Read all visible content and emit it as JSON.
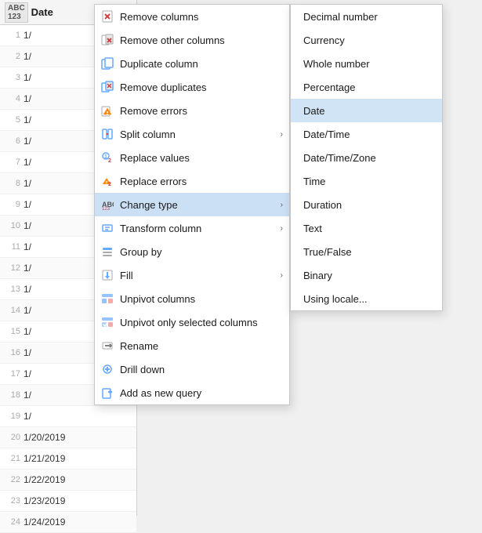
{
  "grid": {
    "header": {
      "type_badge": "ABC\n123",
      "column_name": "Date"
    },
    "rows": [
      {
        "num": 1,
        "value": "1/"
      },
      {
        "num": 2,
        "value": "1/"
      },
      {
        "num": 3,
        "value": "1/"
      },
      {
        "num": 4,
        "value": "1/"
      },
      {
        "num": 5,
        "value": "1/"
      },
      {
        "num": 6,
        "value": "1/"
      },
      {
        "num": 7,
        "value": "1/"
      },
      {
        "num": 8,
        "value": "1/"
      },
      {
        "num": 9,
        "value": "1/"
      },
      {
        "num": 10,
        "value": "1/"
      },
      {
        "num": 11,
        "value": "1/"
      },
      {
        "num": 12,
        "value": "1/"
      },
      {
        "num": 13,
        "value": "1/"
      },
      {
        "num": 14,
        "value": "1/"
      },
      {
        "num": 15,
        "value": "1/"
      },
      {
        "num": 16,
        "value": "1/"
      },
      {
        "num": 17,
        "value": "1/"
      },
      {
        "num": 18,
        "value": "1/"
      },
      {
        "num": 19,
        "value": "1/"
      },
      {
        "num": 20,
        "value": "1/20/2019"
      },
      {
        "num": 21,
        "value": "1/21/2019"
      },
      {
        "num": 22,
        "value": "1/22/2019"
      },
      {
        "num": 23,
        "value": "1/23/2019"
      },
      {
        "num": 24,
        "value": "1/24/2019"
      }
    ]
  },
  "context_menu": {
    "items": [
      {
        "id": "remove-columns",
        "label": "Remove columns",
        "has_arrow": false,
        "icon": "x-icon"
      },
      {
        "id": "remove-other-columns",
        "label": "Remove other columns",
        "has_arrow": false,
        "icon": "x-other-icon"
      },
      {
        "id": "duplicate-column",
        "label": "Duplicate column",
        "has_arrow": false,
        "icon": "dup-icon"
      },
      {
        "id": "remove-duplicates",
        "label": "Remove duplicates",
        "has_arrow": false,
        "icon": "dup-x-icon"
      },
      {
        "id": "remove-errors",
        "label": "Remove errors",
        "has_arrow": false,
        "icon": "err-icon"
      },
      {
        "id": "split-column",
        "label": "Split column",
        "has_arrow": true,
        "icon": "split-icon"
      },
      {
        "id": "replace-values",
        "label": "Replace values",
        "has_arrow": false,
        "icon": "replace-icon"
      },
      {
        "id": "replace-errors",
        "label": "Replace errors",
        "has_arrow": false,
        "icon": "replace-err-icon"
      },
      {
        "id": "change-type",
        "label": "Change type",
        "has_arrow": true,
        "icon": "type-icon",
        "active": true
      },
      {
        "id": "transform-column",
        "label": "Transform column",
        "has_arrow": true,
        "icon": "transform-icon"
      },
      {
        "id": "group-by",
        "label": "Group by",
        "has_arrow": false,
        "icon": "group-icon"
      },
      {
        "id": "fill",
        "label": "Fill",
        "has_arrow": true,
        "icon": "fill-icon"
      },
      {
        "id": "unpivot-columns",
        "label": "Unpivot columns",
        "has_arrow": false,
        "icon": "unpivot-icon"
      },
      {
        "id": "unpivot-selected",
        "label": "Unpivot only selected columns",
        "has_arrow": false,
        "icon": "unpivot-sel-icon"
      },
      {
        "id": "rename",
        "label": "Rename",
        "has_arrow": false,
        "icon": "rename-icon"
      },
      {
        "id": "drill-down",
        "label": "Drill down",
        "has_arrow": false,
        "icon": "drill-icon"
      },
      {
        "id": "add-query",
        "label": "Add as new query",
        "has_arrow": false,
        "icon": "add-icon"
      }
    ]
  },
  "submenu_changetype": {
    "items": [
      {
        "id": "decimal",
        "label": "Decimal number",
        "selected": false
      },
      {
        "id": "currency",
        "label": "Currency",
        "selected": false
      },
      {
        "id": "whole",
        "label": "Whole number",
        "selected": false
      },
      {
        "id": "percentage",
        "label": "Percentage",
        "selected": false
      },
      {
        "id": "date",
        "label": "Date",
        "selected": true
      },
      {
        "id": "datetime",
        "label": "Date/Time",
        "selected": false
      },
      {
        "id": "datetimezone",
        "label": "Date/Time/Zone",
        "selected": false
      },
      {
        "id": "time",
        "label": "Time",
        "selected": false
      },
      {
        "id": "duration",
        "label": "Duration",
        "selected": false
      },
      {
        "id": "text",
        "label": "Text",
        "selected": false
      },
      {
        "id": "truefalse",
        "label": "True/False",
        "selected": false
      },
      {
        "id": "binary",
        "label": "Binary",
        "selected": false
      },
      {
        "id": "locale",
        "label": "Using locale...",
        "selected": false
      }
    ]
  }
}
